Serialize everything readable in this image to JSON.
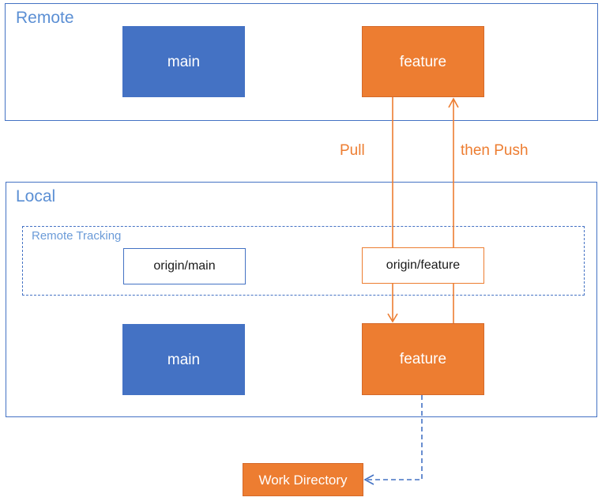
{
  "diagram": {
    "title_remote": "Remote",
    "title_local": "Local",
    "title_remote_tracking": "Remote Tracking",
    "colors": {
      "blue": "#4472C4",
      "orange": "#ED7D31",
      "label_blue": "#5B8FD4",
      "white": "#FFFFFF",
      "text_dark": "#1A1A1A"
    },
    "remote": {
      "label": "Remote",
      "nodes": [
        {
          "id": "remote-main",
          "label": "main",
          "style": "blue-filled"
        },
        {
          "id": "remote-feature",
          "label": "feature",
          "style": "orange-filled"
        }
      ]
    },
    "local": {
      "label": "Local",
      "remote_tracking": {
        "label": "Remote Tracking",
        "nodes": [
          {
            "id": "origin-main",
            "label": "origin/main",
            "style": "white-blue-outline"
          },
          {
            "id": "origin-feature",
            "label": "origin/feature",
            "style": "white-orange-outline"
          }
        ]
      },
      "nodes": [
        {
          "id": "local-main",
          "label": "main",
          "style": "blue-filled"
        },
        {
          "id": "local-feature",
          "label": "feature",
          "style": "orange-filled"
        }
      ]
    },
    "work_directory": {
      "id": "work-directory",
      "label": "Work Directory",
      "style": "orange-filled"
    },
    "edges": [
      {
        "id": "pull",
        "label": "Pull",
        "color": "#ED7D31",
        "from": "remote-feature",
        "to": "local-feature",
        "direction": "down"
      },
      {
        "id": "push",
        "label": "then Push",
        "color": "#ED7D31",
        "from": "local-feature",
        "to": "remote-feature",
        "direction": "up"
      },
      {
        "id": "checkout",
        "label": "",
        "color": "#4472C4",
        "from": "local-feature",
        "to": "work-directory",
        "direction": "left",
        "style": "dashed"
      }
    ]
  }
}
